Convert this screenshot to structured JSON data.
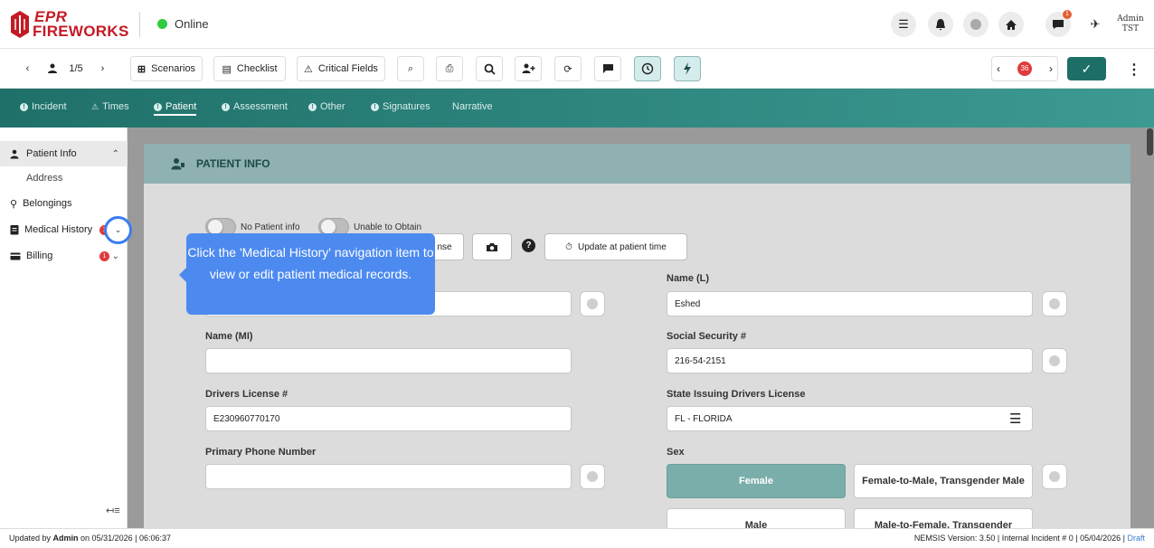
{
  "app": {
    "logo_top": "EPR",
    "logo_bottom": "FIREWORKS",
    "status": "Online",
    "admin_name": "Admin",
    "admin_sub": "TST",
    "notif_count": "1"
  },
  "toolbar": {
    "record_pos": "1/5",
    "scenarios": "Scenarios",
    "checklist": "Checklist",
    "critical_fields": "Critical Fields",
    "issue_count": "36"
  },
  "tabs": [
    {
      "label": "Incident"
    },
    {
      "label": "Times"
    },
    {
      "label": "Patient"
    },
    {
      "label": "Assessment"
    },
    {
      "label": "Other"
    },
    {
      "label": "Signatures"
    },
    {
      "label": "Narrative"
    }
  ],
  "sidebar": {
    "items": [
      {
        "label": "Patient Info"
      },
      {
        "label": "Address"
      },
      {
        "label": "Belongings"
      },
      {
        "label": "Medical History",
        "badge": "1"
      },
      {
        "label": "Billing",
        "badge": "1"
      }
    ]
  },
  "section": {
    "title": "PATIENT INFO",
    "no_patient_info": "No Patient info",
    "unable_to_obtain": "Unable to Obtain",
    "license_btn": "nse",
    "update_btn": "Update at patient time"
  },
  "fields": {
    "name_l_label": "Name (L)",
    "name_l_value": "Eshed",
    "name_mi_label": "Name (MI)",
    "name_mi_value": "",
    "ssn_label": "Social Security #",
    "ssn_value": "216-54-2151",
    "dl_label": "Drivers License #",
    "dl_value": "E230960770170",
    "state_dl_label": "State Issuing Drivers License",
    "state_dl_value": "FL - FLORIDA",
    "phone_label": "Primary Phone Number",
    "phone_value": "",
    "sex_label": "Sex",
    "sex_options": [
      "Female",
      "Female-to-Male, Transgender Male",
      "Male",
      "Male-to-Female, Transgender"
    ],
    "sex_selected": "Female"
  },
  "tooltip": {
    "text": "Click the 'Medical History' navigation item to view or edit patient medical records."
  },
  "footer": {
    "updated_prefix": "Updated by ",
    "updated_by": "Admin",
    "updated_suffix": " on 05/31/2026 | 06:06:37",
    "nemsis": "NEMSIS Version: 3.50 | Internal Incident # 0 | 05/04/2026 | ",
    "draft": "Draft"
  },
  "colors": {
    "brand_red": "#c41a25",
    "teal_dark": "#1f7068",
    "tooltip_blue": "#4c8af0",
    "selected_sex": "#7aaeab"
  }
}
